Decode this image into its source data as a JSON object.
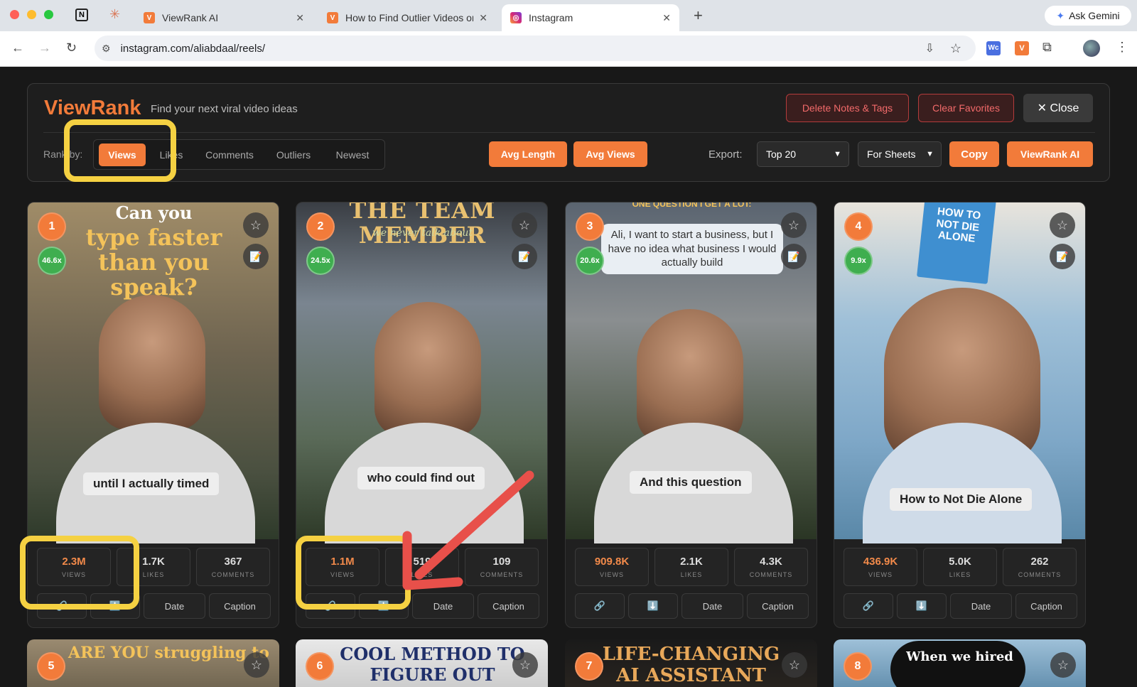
{
  "browser": {
    "tabs": [
      {
        "label": "ViewRank AI"
      },
      {
        "label": "How to Find Outlier Videos on"
      },
      {
        "label": "Instagram"
      }
    ],
    "url": "instagram.com/aliabdaal/reels/",
    "gemini": "Ask Gemini",
    "new_tab": "+"
  },
  "header": {
    "logo": "ViewRank",
    "tagline": "Find your next viral video ideas",
    "delete_label": "Delete Notes & Tags",
    "clear_label": "Clear Favorites",
    "close_label": "✕ Close"
  },
  "rankby": {
    "label": "Rank by:",
    "tabs": [
      "Views",
      "Likes",
      "Comments",
      "Outliers",
      "Newest"
    ],
    "active": "Views"
  },
  "avg": {
    "length": "Avg Length",
    "views": "Avg Views"
  },
  "export": {
    "label": "Export:",
    "count": "Top 20",
    "format": "For Sheets",
    "copy": "Copy",
    "ai": "ViewRank AI"
  },
  "stat_labels": {
    "views": "VIEWS",
    "likes": "LIKES",
    "comments": "COMMENTS"
  },
  "actions": {
    "link": "🔗",
    "download": "⬇️",
    "date": "Date",
    "caption": "Caption"
  },
  "icons": {
    "star": "☆",
    "note": "📝"
  },
  "cards": [
    {
      "rank": "1",
      "mult": "46.6x",
      "hook_top": "Can you",
      "hook": "type faster than you speak?",
      "caption": "until I actually timed",
      "views": "2.3M",
      "likes": "1.7K",
      "comments": "367"
    },
    {
      "rank": "2",
      "mult": "24.5x",
      "hook": "THE TEAM MEMBER",
      "hook_sub": "we never talk about",
      "caption": "who could find out",
      "views": "1.1M",
      "likes": "519",
      "comments": "109"
    },
    {
      "rank": "3",
      "mult": "20.6x",
      "hook_small": "Ali, I want to start a business, but I have no idea what business I would actually build",
      "hook_top": "ONE QUESTION I GET A LOT:",
      "caption": "And this question",
      "views": "909.8K",
      "likes": "2.1K",
      "comments": "4.3K"
    },
    {
      "rank": "4",
      "mult": "9.9x",
      "book": "HOW TO NOT DIE ALONE",
      "caption": "How to Not Die Alone",
      "views": "436.9K",
      "likes": "5.0K",
      "comments": "262"
    }
  ],
  "bottom_cards": [
    {
      "rank": "5",
      "text": "ARE YOU struggling to"
    },
    {
      "rank": "6",
      "text": "COOL METHOD TO FIGURE OUT"
    },
    {
      "rank": "7",
      "text": "LIFE-CHANGING AI ASSISTANT"
    },
    {
      "rank": "8",
      "text": "When we hired"
    }
  ]
}
